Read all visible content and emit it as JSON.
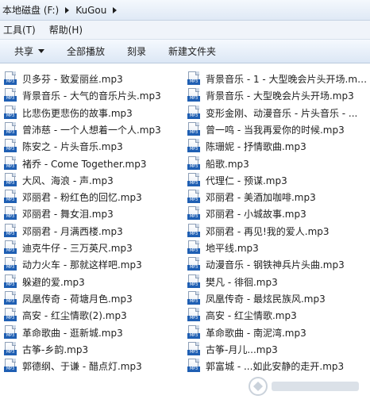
{
  "address_bar": {
    "crumbs": [
      "本地磁盘 (F:)",
      "KuGou"
    ]
  },
  "menu": {
    "items": [
      "工具(T)",
      "帮助(H)"
    ]
  },
  "commands": {
    "share": "共享",
    "play_all": "全部播放",
    "burn": "刻录",
    "new_folder": "新建文件夹"
  },
  "files": {
    "left": [
      "贝多芬 - 致爱丽丝.mp3",
      "背景音乐 - 大气的音乐片头.mp3",
      "比悲伤更悲伤的故事.mp3",
      "曾沛慈 - 一个人想着一个人.mp3",
      "陈安之 - 片头音乐.mp3",
      "褚乔 - Come Together.mp3",
      "大风、海浪 - 声.mp3",
      "邓丽君 - 粉红色的回忆.mp3",
      "邓丽君 - 舞女泪.mp3",
      "邓丽君 - 月满西楼.mp3",
      "迪克牛仔 - 三万英尺.mp3",
      "动力火车 - 那就这样吧.mp3",
      "躲避的爱.mp3",
      "凤凰传奇 - 荷塘月色.mp3",
      "高安 - 红尘情歌(2).mp3",
      "革命歌曲 - 逛新城.mp3",
      "古筝-乡韵.mp3",
      "郭德纲、于谦 - 醋点灯.mp3"
    ],
    "right": [
      "背景音乐 - 1 - 大型晚会片头开场.mp3",
      "背景音乐 - 大型晚会片头开场.mp3",
      "变形金刚、动漫音乐 - 片头音乐 - ...",
      "曾一鸣 - 当我再爱你的时候.mp3",
      "陈珊妮 - 抒情歌曲.mp3",
      "船歌.mp3",
      "代理仁 - 预谋.mp3",
      "邓丽君 - 美酒加咖啡.mp3",
      "邓丽君 - 小城故事.mp3",
      "邓丽君 - 再见!我的爱人.mp3",
      "地平线.mp3",
      "动漫音乐 - 钢铁神兵片头曲.mp3",
      "樊凡 - 徘徊.mp3",
      "凤凰传奇 - 最炫民族风.mp3",
      "高安 - 红尘情歌.mp3",
      "革命歌曲 - 南泥湾.mp3",
      "古筝-月儿...mp3",
      "郭富城 - ...如此安静的走开.mp3"
    ],
    "icon_tag": "MP3"
  }
}
